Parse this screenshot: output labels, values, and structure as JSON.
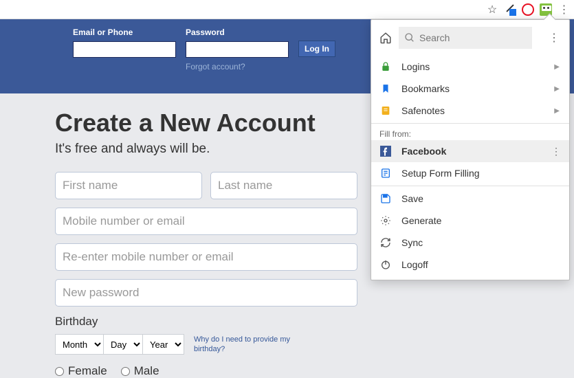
{
  "fb": {
    "email_label": "Email or Phone",
    "password_label": "Password",
    "login_btn": "Log In",
    "forgot": "Forgot account?"
  },
  "signup": {
    "title": "Create a New Account",
    "subtitle": "It's free and always will be.",
    "first_name_ph": "First name",
    "last_name_ph": "Last name",
    "mobile_ph": "Mobile number or email",
    "reenter_ph": "Re-enter mobile number or email",
    "password_ph": "New password",
    "birthday_label": "Birthday",
    "month": "Month",
    "day": "Day",
    "year": "Year",
    "why": "Why do I need to provide my birthday?",
    "female": "Female",
    "male": "Male"
  },
  "popup": {
    "search_ph": "Search",
    "logins": "Logins",
    "bookmarks": "Bookmarks",
    "safenotes": "Safenotes",
    "fill_from": "Fill from:",
    "facebook": "Facebook",
    "setup_ff": "Setup Form Filling",
    "save": "Save",
    "generate": "Generate",
    "sync": "Sync",
    "logoff": "Logoff"
  }
}
